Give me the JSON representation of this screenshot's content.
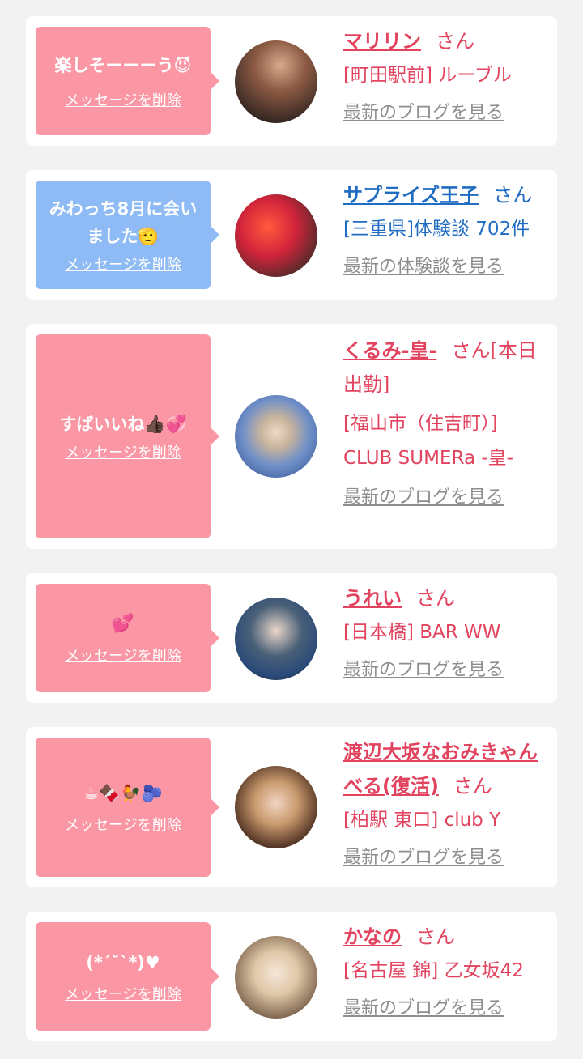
{
  "delete_label": "メッセージを削除",
  "suffix": "さん",
  "colors": {
    "pink": "#fb96a4",
    "blue": "#8ebbf6",
    "name_pink": "#e2445f",
    "name_blue": "#1f6cc2",
    "link_gray": "#8d8d8d"
  },
  "items": [
    {
      "message": "楽しそーーーう😈",
      "name": "マリリン",
      "shop": "[町田駅前] ルーブル",
      "latest": "最新のブログを見る"
    },
    {
      "message": "みわっち8月に会いました🫡",
      "name": "サプライズ王子",
      "shop": "[三重県]体験談 702件",
      "latest": "最新の体験談を見る"
    },
    {
      "message": "すばいいね👍🏿💞",
      "name": "くるみ-皇-",
      "name_extra": "[本日出勤]",
      "shop": "[福山市（住吉町）] CLUB SUMERa -皇-",
      "latest": "最新のブログを見る"
    },
    {
      "message": "💕",
      "name": "うれい",
      "shop": "[日本橋] BAR WW",
      "latest": "最新のブログを見る"
    },
    {
      "message": "☕🍫🐓🫐",
      "name": "渡辺大坂なおみきゃんべる(復活)",
      "shop": "[柏駅 東口] club Y",
      "latest": "最新のブログを見る"
    },
    {
      "message": "(*´˘`*)♥",
      "name": "かなの",
      "shop": "[名古屋 錦] 乙女坂42",
      "latest": "最新のブログを見る"
    }
  ]
}
